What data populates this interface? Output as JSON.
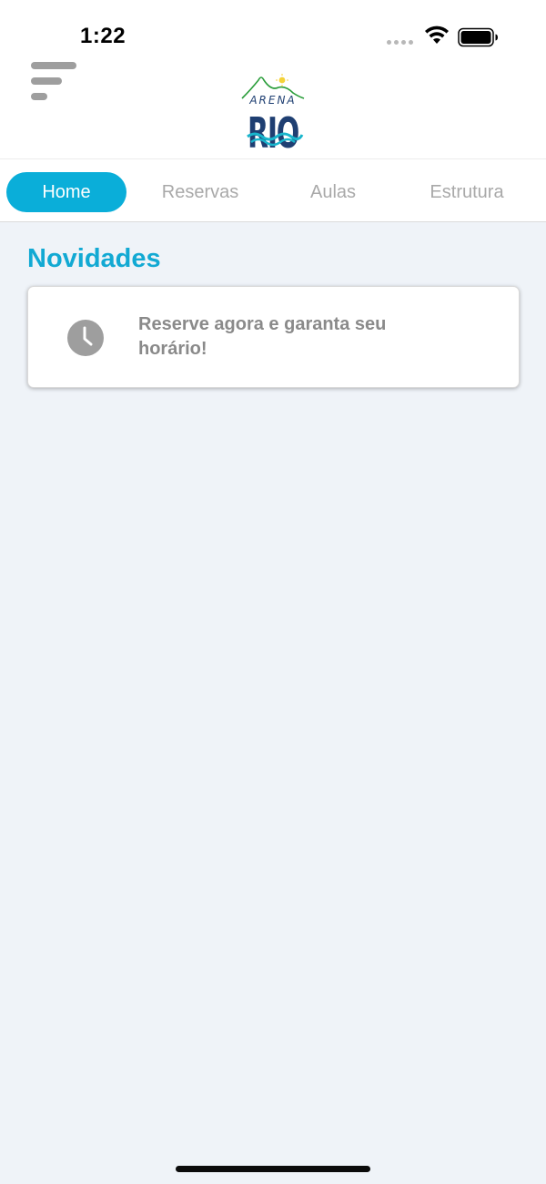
{
  "status_bar": {
    "time": "1:22",
    "icons": [
      "cellular-signal-icon",
      "wifi-icon",
      "battery-icon"
    ]
  },
  "header": {
    "menu_icon": "menu-icon",
    "logo": {
      "line1": "ARENA",
      "line2": "RIO",
      "colors": {
        "navy": "#1f3f72",
        "teal": "#18b5cc",
        "green": "#2a9d3a",
        "sun": "#f4d238"
      }
    }
  },
  "tabs": [
    {
      "label": "Home",
      "active": true
    },
    {
      "label": "Reservas",
      "active": false
    },
    {
      "label": "Aulas",
      "active": false
    },
    {
      "label": "Estrutura",
      "active": false
    }
  ],
  "main": {
    "section_title": "Novidades",
    "news": [
      {
        "icon": "clock-icon",
        "text": "Reserve agora e garanta seu horário!"
      }
    ]
  },
  "colors": {
    "accent": "#0aaed9",
    "title": "#12a9d3",
    "background": "#eff3f8",
    "muted_text": "#8a8a8a",
    "inactive_tab": "#a9a9a9"
  }
}
